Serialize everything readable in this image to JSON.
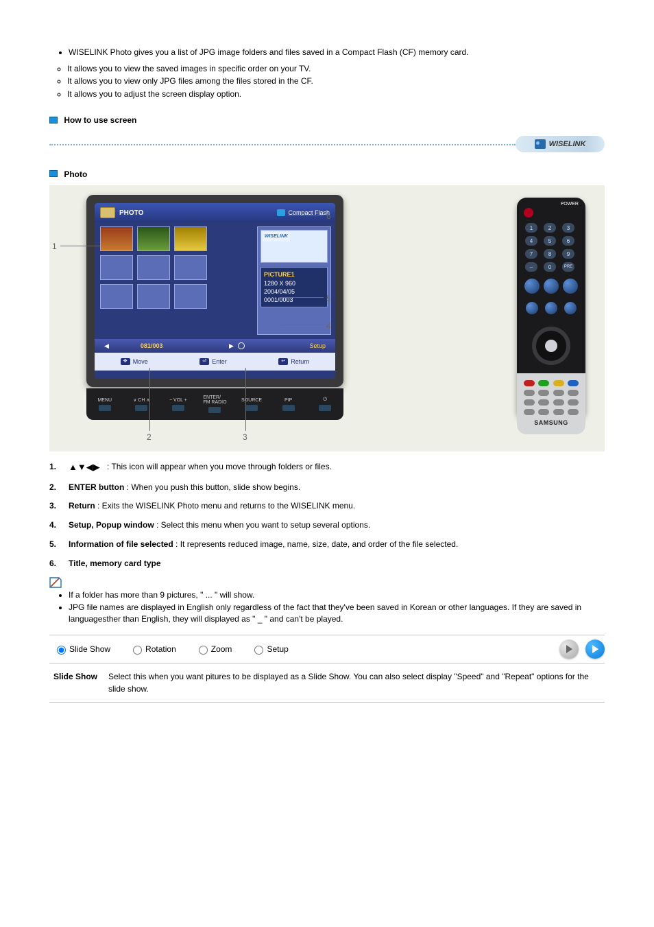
{
  "intro": {
    "line1": "WISELINK Photo gives you a list of JPG image folders and files saved in a Compact Flash (CF) memory card.",
    "sublist": [
      "It allows you to view the saved images in specific order on your TV.",
      "It allows you to view only JPG files among the files stored in the CF.",
      "It allows you to adjust the screen display option."
    ]
  },
  "ribbon": {
    "label": "WISELINK"
  },
  "section1": {
    "title": "How to use screen"
  },
  "onscreen": {
    "header_left": "PHOTO",
    "header_right": "Compact Flash",
    "preview_label": "WISELINK",
    "info": {
      "title": "PICTURE1",
      "res": "1280 X 960",
      "date": "2004/04/05",
      "count": "0001/0003"
    },
    "pagebar": {
      "page": "081/003",
      "setup": "Setup"
    },
    "help": {
      "move": "Move",
      "enter": "Enter",
      "return": "Return"
    }
  },
  "tvbuttons": [
    "MENU",
    "∨  CH  ∧",
    "−  VOL  +",
    "ENTER/\nFM RADIO",
    "SOURCE",
    "PIP",
    "⏻"
  ],
  "remote": {
    "power_label": "POWER",
    "brand": "SAMSUNG"
  },
  "callouts": {
    "n1": "1",
    "n2": "2",
    "n3": "3",
    "n4": "4",
    "n5": "5",
    "n6": "6"
  },
  "desc": {
    "arrows": "▲▼◀▶",
    "i1": {
      "k": "1.",
      "b": "",
      "arrowtxt": ": This icon will appear when you move through folders or files."
    },
    "i2": {
      "k": "2.",
      "b": "ENTER button",
      "t": ": When you push this button, slide show begins."
    },
    "i3": {
      "k": "3.",
      "b": "Return",
      "t": ": Exits the WISELINK Photo menu and returns to the WISELINK menu."
    },
    "i4": {
      "k": "4.",
      "b": "Setup, Popup window",
      "t": ": Select this menu when you want to setup several options."
    },
    "i5": {
      "k": "5.",
      "b": "Information of file selected",
      "t": ": It represents reduced image, name, size, date, and order of the file selected."
    },
    "i6": {
      "k": "6.",
      "b": "Title, memory card type"
    }
  },
  "notes": {
    "n1": "If a folder has more than 9 pictures, \" ... \" will show.",
    "n2": "JPG file names are displayed in English only regardless of the fact that they've been saved in Korean or other languages. If they are saved in languagesther than English, they will displayed as \" _ \" and can't be played."
  },
  "tabs": [
    "Slide Show",
    "Rotation",
    "Zoom",
    "Setup"
  ],
  "final": {
    "k": "Slide Show",
    "t": "Select this when you want pitures to be displayed as a Slide Show. You can also select display \"Speed\" and \"Repeat\" options for the slide show."
  }
}
